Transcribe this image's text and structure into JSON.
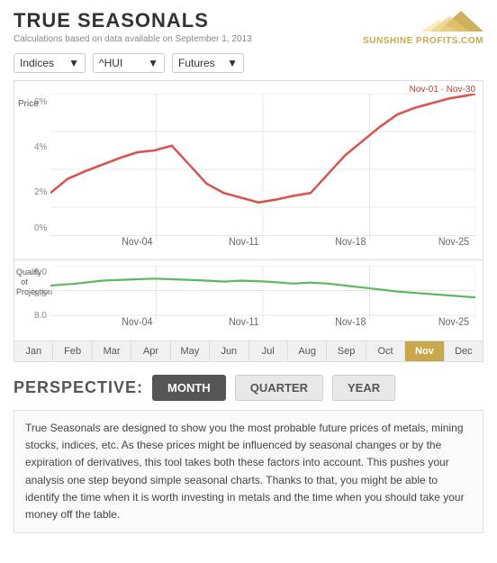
{
  "header": {
    "title": "TRUE SEASONALS",
    "subtitle": "Calculations based on data available on September 1, 2013",
    "logo_text": "SUNSHINE PROFITS.COM"
  },
  "dropdowns": [
    {
      "label": "Indices",
      "id": "dd1"
    },
    {
      "label": "^HUI",
      "id": "dd2"
    },
    {
      "label": "Futures",
      "id": "dd3"
    }
  ],
  "chart": {
    "date_range": "Nov-01 · Nov-30",
    "y_labels_price": [
      "6%",
      "4%",
      "2%",
      "0%"
    ],
    "y_labels_quality": [
      "9.0",
      "8.5",
      "8.0"
    ],
    "x_labels": [
      "Nov-04",
      "Nov-11",
      "Nov-18",
      "Nov-25"
    ]
  },
  "months": [
    {
      "label": "Jan",
      "active": false
    },
    {
      "label": "Feb",
      "active": false
    },
    {
      "label": "Mar",
      "active": false
    },
    {
      "label": "Apr",
      "active": false
    },
    {
      "label": "May",
      "active": false
    },
    {
      "label": "Jun",
      "active": false
    },
    {
      "label": "Jul",
      "active": false
    },
    {
      "label": "Aug",
      "active": false
    },
    {
      "label": "Sep",
      "active": false
    },
    {
      "label": "Oct",
      "active": false
    },
    {
      "label": "Nov",
      "active": true
    },
    {
      "label": "Dec",
      "active": false
    }
  ],
  "perspective": {
    "label": "PERSPECTIVE:",
    "buttons": [
      {
        "label": "MONTH",
        "active": true
      },
      {
        "label": "QUARTER",
        "active": false
      },
      {
        "label": "YEAR",
        "active": false
      }
    ]
  },
  "description": "True Seasonals are designed to show you the most probable future prices of metals, mining stocks, indices, etc. As these prices might be influenced by seasonal changes or by the expiration of derivatives, this tool takes both these factors into account. This pushes your analysis one step beyond simple seasonal charts. Thanks to that, you might be able to identify the time when it is worth investing in metals and the time when you should take your money off the table."
}
